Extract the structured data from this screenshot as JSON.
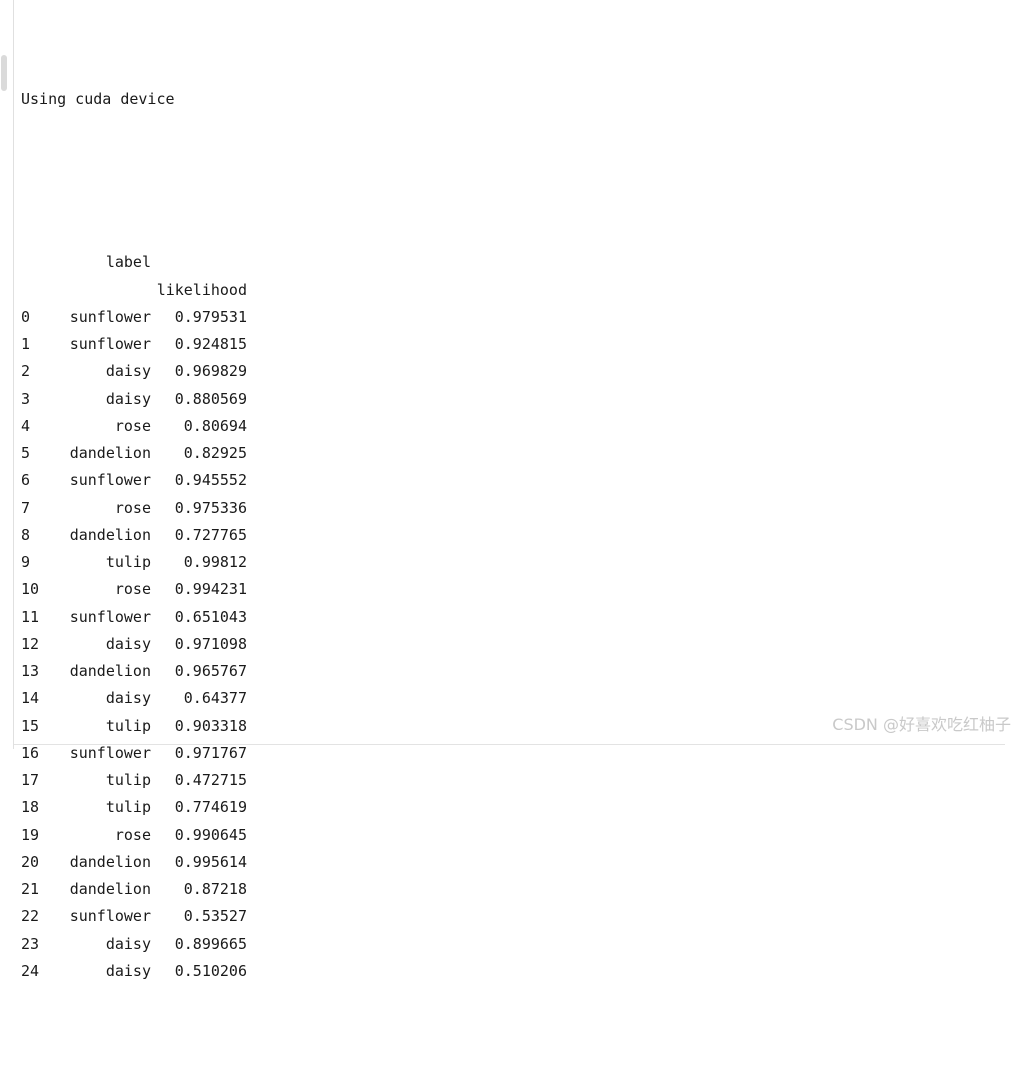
{
  "console": {
    "device_line": "Using cuda device",
    "columns": {
      "index_header": "",
      "label_header": "label",
      "value_header": "likelihood"
    },
    "rows": [
      {
        "index": "0",
        "label": "sunflower",
        "likelihood": "0.979531"
      },
      {
        "index": "1",
        "label": "sunflower",
        "likelihood": "0.924815"
      },
      {
        "index": "2",
        "label": "daisy",
        "likelihood": "0.969829"
      },
      {
        "index": "3",
        "label": "daisy",
        "likelihood": "0.880569"
      },
      {
        "index": "4",
        "label": "rose",
        "likelihood": "0.80694"
      },
      {
        "index": "5",
        "label": "dandelion",
        "likelihood": "0.82925"
      },
      {
        "index": "6",
        "label": "sunflower",
        "likelihood": "0.945552"
      },
      {
        "index": "7",
        "label": "rose",
        "likelihood": "0.975336"
      },
      {
        "index": "8",
        "label": "dandelion",
        "likelihood": "0.727765"
      },
      {
        "index": "9",
        "label": "tulip",
        "likelihood": "0.99812"
      },
      {
        "index": "10",
        "label": "rose",
        "likelihood": "0.994231"
      },
      {
        "index": "11",
        "label": "sunflower",
        "likelihood": "0.651043"
      },
      {
        "index": "12",
        "label": "daisy",
        "likelihood": "0.971098"
      },
      {
        "index": "13",
        "label": "dandelion",
        "likelihood": "0.965767"
      },
      {
        "index": "14",
        "label": "daisy",
        "likelihood": "0.64377"
      },
      {
        "index": "15",
        "label": "tulip",
        "likelihood": "0.903318"
      },
      {
        "index": "16",
        "label": "sunflower",
        "likelihood": "0.971767"
      },
      {
        "index": "17",
        "label": "tulip",
        "likelihood": "0.472715"
      },
      {
        "index": "18",
        "label": "tulip",
        "likelihood": "0.774619"
      },
      {
        "index": "19",
        "label": "rose",
        "likelihood": "0.990645"
      },
      {
        "index": "20",
        "label": "dandelion",
        "likelihood": "0.995614"
      },
      {
        "index": "21",
        "label": "dandelion",
        "likelihood": "0.87218"
      },
      {
        "index": "22",
        "label": "sunflower",
        "likelihood": "0.53527"
      },
      {
        "index": "23",
        "label": "daisy",
        "likelihood": "0.899665"
      },
      {
        "index": "24",
        "label": "daisy",
        "likelihood": "0.510206"
      }
    ]
  },
  "watermark": {
    "text": "CSDN @好喜欢吃红柚子"
  },
  "colors": {
    "background": "#ffffff",
    "text": "#1a1a1a",
    "divider": "#e0e0e0",
    "scrollbar_thumb": "#dadada",
    "watermark": "#c9c9c9"
  }
}
